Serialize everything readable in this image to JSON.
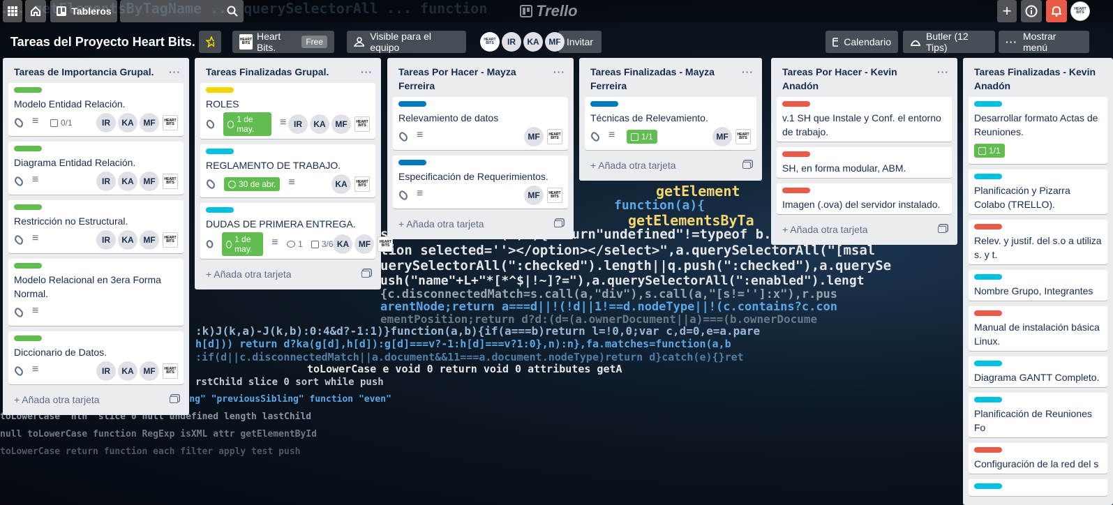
{
  "header": {
    "boards_label": "Tableros",
    "logo": "Trello"
  },
  "board": {
    "title": "Tareas del Proyecto Heart Bits.",
    "team": "Heart Bits.",
    "team_badge": "Free",
    "visibility": "Visible para el equipo",
    "members": [
      "IR",
      "KA",
      "MF"
    ],
    "invite": "Invitar",
    "calendar": "Calendario",
    "butler": "Butler (12 Tips)",
    "menu": "Mostrar menú"
  },
  "add_card": "Añada otra tarjeta",
  "lists": [
    {
      "title": "Tareas de Importancia Grupal.",
      "cards": [
        {
          "label": "green",
          "title": "Modelo Entidad Relación.",
          "checklist": "0/1",
          "members": [
            "IR",
            "KA",
            "MF"
          ]
        },
        {
          "label": "green",
          "title": "Diagrama Entidad Relación.",
          "members": [
            "IR",
            "KA",
            "MF"
          ]
        },
        {
          "label": "green",
          "title": "Restricción no Estructural.",
          "members": [
            "IR",
            "KA",
            "MF"
          ]
        },
        {
          "label": "green",
          "title": "Modelo Relacional en 3era Forma Normal."
        },
        {
          "label": "green",
          "title": "Diccionario de Datos.",
          "members": [
            "IR",
            "KA",
            "MF"
          ]
        }
      ]
    },
    {
      "title": "Tareas Finalizadas Grupal.",
      "cards": [
        {
          "label": "yellow",
          "title": "ROLES",
          "due": "1 de may.",
          "members": [
            "IR",
            "KA",
            "MF"
          ]
        },
        {
          "label": "sky",
          "title": "REGLAMENTO DE TRABAJO.",
          "due": "30 de abr.",
          "members": [
            "KA"
          ]
        },
        {
          "label": "sky",
          "title": "DUDAS DE PRIMERA ENTREGA.",
          "due": "1 de may.",
          "comments": "1",
          "checklist": "3/6",
          "members": [
            "KA",
            "MF"
          ]
        }
      ]
    },
    {
      "title": "Tareas Por Hacer - Mayza Ferreira",
      "cards": [
        {
          "label": "blue",
          "title": "Relevamiento de datos",
          "members": [
            "MF"
          ]
        },
        {
          "label": "blue",
          "title": "Especificación de Requerimientos.",
          "members": [
            "MF"
          ]
        }
      ]
    },
    {
      "title": "Tareas Finalizadas - Mayza Ferreira",
      "cards": [
        {
          "label": "blue",
          "title": "Técnicas de Relevamiento.",
          "checklist": "1/1",
          "members": [
            "MF"
          ]
        }
      ]
    },
    {
      "title": "Tareas Por Hacer - Kevin Anadón",
      "cards": [
        {
          "label": "red",
          "title": "v.1 SH que Instale y Conf. el entorno de trabajo."
        },
        {
          "label": "red",
          "title": "SH, en forma modular, ABM."
        },
        {
          "label": "red",
          "title": "Imagen (.ova) del servidor instalado."
        }
      ]
    },
    {
      "title": "Tareas Finalizadas - Kevin Anadón",
      "cards": [
        {
          "label": "sky",
          "title": "Desarrollar formato Actas de Reuniones.",
          "checklist": "1/1"
        },
        {
          "label": "sky",
          "title": "Planificación y Pizarra Colabo (TRELLO)."
        },
        {
          "label": "red",
          "title": "Relev. y justif. del s.o a utiliza s. y t."
        },
        {
          "label": "sky",
          "title": "Nombre Grupo, Integrantes"
        },
        {
          "label": "red",
          "title": "Manual de instalación básica Linux."
        },
        {
          "label": "sky",
          "title": "Diagrama GANTT Completo."
        },
        {
          "label": "sky",
          "title": "Planificación de Reuniones Fo"
        },
        {
          "label": "red",
          "title": "Configuración de la red del s"
        },
        {
          "label": "sky",
          "title": ""
        }
      ]
    }
  ]
}
